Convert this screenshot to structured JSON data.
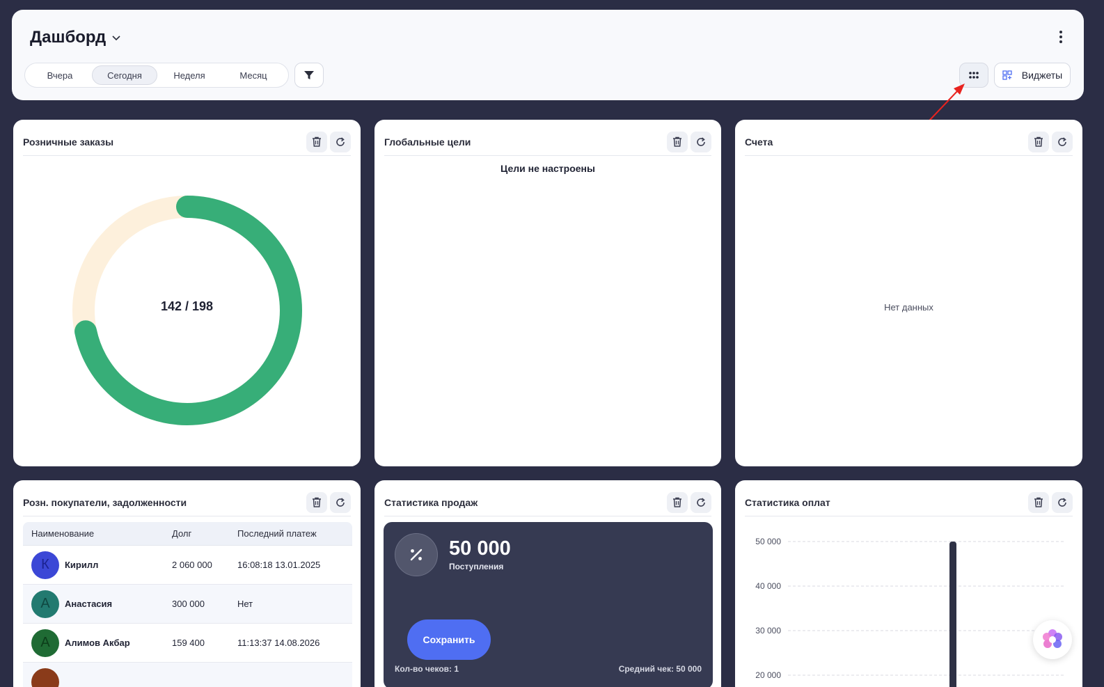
{
  "header": {
    "title": "Дашборд",
    "periods": [
      "Вчера",
      "Сегодня",
      "Неделя",
      "Месяц"
    ],
    "active_period": "Сегодня",
    "widgets_label": "Виджеты"
  },
  "retail_orders": {
    "title": "Розничные заказы",
    "center_label": "142 / 198",
    "completed": 142,
    "total": 198,
    "colors": {
      "done": "#37ae78",
      "rest": "#fdf0dc"
    }
  },
  "global_goals": {
    "title": "Глобальные цели",
    "message": "Цели не настроены"
  },
  "accounts": {
    "title": "Счета",
    "message": "Нет данных"
  },
  "debtors": {
    "title": "Розн. покупатели, задолженности",
    "columns": [
      "Наименование",
      "Долг",
      "Последний платеж"
    ],
    "rows": [
      {
        "initial": "К",
        "name": "Кирилл",
        "debt": "2 060 000",
        "last_payment": "16:08:18 13.01.2025",
        "color": "#3b47d6"
      },
      {
        "initial": "А",
        "name": "Анастасия",
        "debt": "300 000",
        "last_payment": "Нет",
        "color": "#227a70"
      },
      {
        "initial": "А",
        "name": "Алимов Акбар",
        "debt": "159 400",
        "last_payment": "11:13:37 14.08.2026",
        "color": "#1f6b34"
      }
    ]
  },
  "sales_stats": {
    "title": "Статистика продаж",
    "amount": "50 000",
    "amount_label": "Поступления",
    "save_label": "Сохранить",
    "receipts_count": "Кол-во чеков: 1",
    "avg_receipt": "Средний чек: 50 000"
  },
  "payment_stats": {
    "title": "Статистика оплат"
  },
  "chart_data": {
    "type": "bar",
    "yticks": [
      "50 000",
      "40 000",
      "30 000",
      "20 000"
    ],
    "ylim": [
      0,
      50000
    ],
    "values": [
      50000
    ],
    "grid": true,
    "bar_color": "#2e3145"
  }
}
